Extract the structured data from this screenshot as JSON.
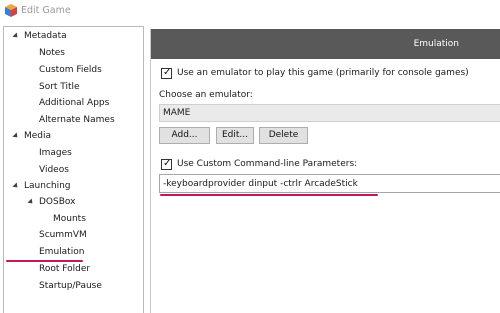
{
  "window": {
    "title": "Edit Game"
  },
  "tree": {
    "items": [
      {
        "label": "Metadata"
      },
      {
        "label": "Notes"
      },
      {
        "label": "Custom Fields"
      },
      {
        "label": "Sort Title"
      },
      {
        "label": "Additional Apps"
      },
      {
        "label": "Alternate Names"
      },
      {
        "label": "Media"
      },
      {
        "label": "Images"
      },
      {
        "label": "Videos"
      },
      {
        "label": "Launching"
      },
      {
        "label": "DOSBox"
      },
      {
        "label": "Mounts"
      },
      {
        "label": "ScummVM"
      },
      {
        "label": "Emulation"
      },
      {
        "label": "Root Folder"
      },
      {
        "label": "Startup/Pause"
      }
    ]
  },
  "panel": {
    "header": "Emulation",
    "use_emulator": {
      "label": "Use an emulator to play this game (primarily for console games)",
      "checked": true
    },
    "choose_label": "Choose an emulator:",
    "emulator_value": "MAME",
    "buttons": {
      "add": "Add...",
      "edit": "Edit...",
      "delete": "Delete"
    },
    "custom_params": {
      "label": "Use Custom Command-line Parameters:",
      "checked": true
    },
    "params_value": "-keyboardprovider dinput -ctrlr ArcadeStick"
  },
  "colors": {
    "accent_underline": "#c2185b",
    "header_bg": "#595959"
  }
}
